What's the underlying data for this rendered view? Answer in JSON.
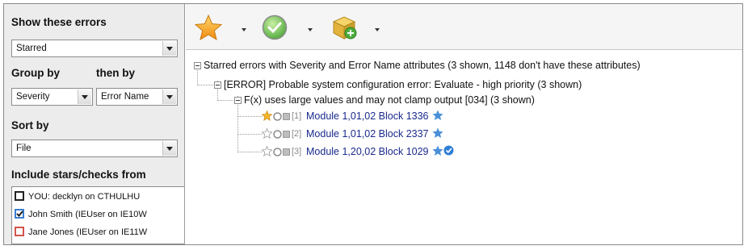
{
  "filters": {
    "show_label": "Show these errors",
    "show_value": "Starred",
    "group_label": "Group by",
    "then_label": "then by",
    "group_value": "Severity",
    "then_value": "Error Name",
    "sort_label": "Sort by",
    "sort_value": "File",
    "include_label": "Include stars/checks from"
  },
  "users": [
    {
      "label": "YOU: decklyn on CTHULHU",
      "checked": false,
      "color": "#222222"
    },
    {
      "label": "John Smith (IEUser on IE10W",
      "checked": true,
      "color": "#3b7fd0"
    },
    {
      "label": "Jane Jones (IEUser on IE11W",
      "checked": false,
      "color": "#d2544c"
    }
  ],
  "toolbar": {
    "buttons": [
      "star-icon",
      "check-circle-icon",
      "package-add-icon"
    ]
  },
  "tree": {
    "root": "Starred errors with Severity and Error Name attributes (3 shown, 1148 don't have these attributes)",
    "group": "[ERROR] Probable system configuration error: Evaluate - high priority (3 shown)",
    "subgroup": "F(x) uses large values and may not clamp output [034] (3 shown)",
    "items": [
      {
        "index": "[1]",
        "label": "Module 1,01,02 Block 1336",
        "starred": true,
        "checked": false
      },
      {
        "index": "[2]",
        "label": "Module 1,01,02 Block 2337",
        "starred": false,
        "checked": false
      },
      {
        "index": "[3]",
        "label": "Module 1,20,02 Block 1029",
        "starred": false,
        "checked": true
      }
    ]
  },
  "colors": {
    "accent_blue": "#4a90d9",
    "link": "#1a2a8c",
    "star_gold": "#f5a623",
    "check_green": "#5cb84a"
  }
}
